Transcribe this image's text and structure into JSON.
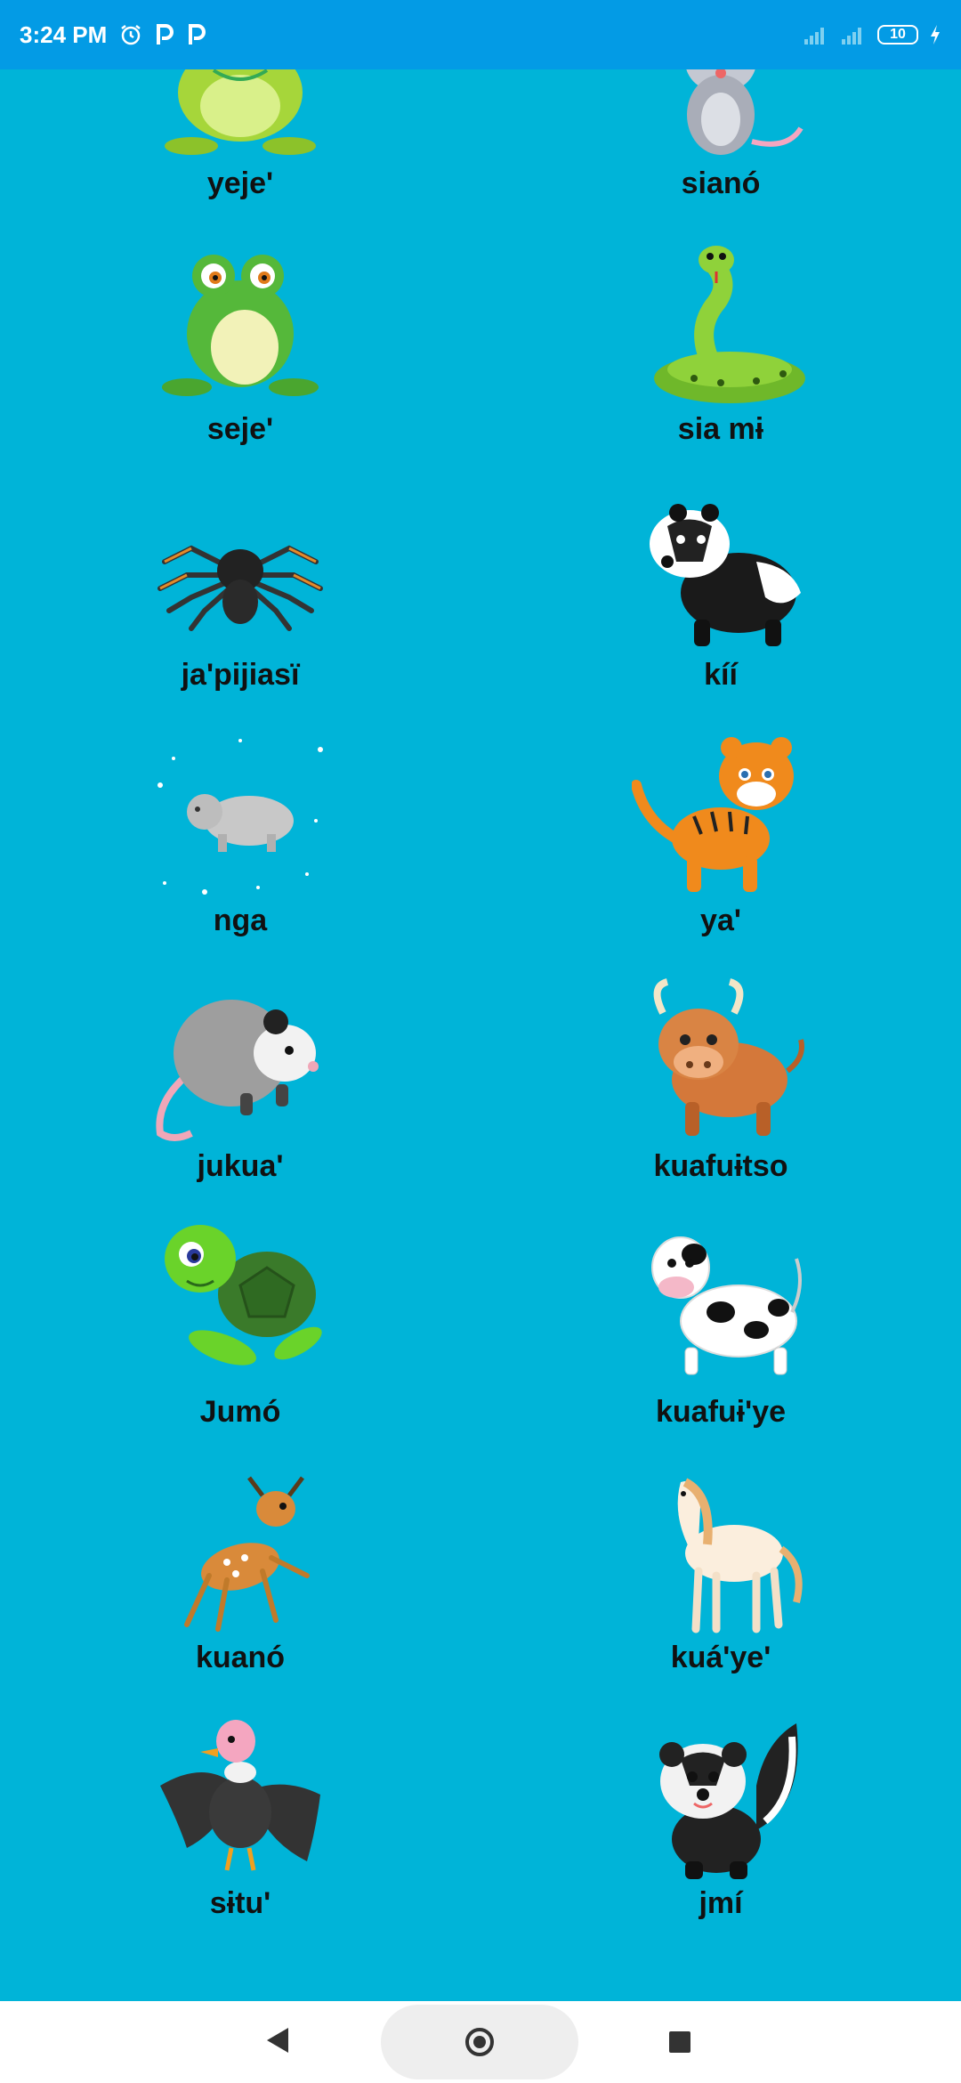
{
  "status_bar": {
    "time": "3:24 PM",
    "battery": "10"
  },
  "animals": [
    {
      "label": "yeje'",
      "icon": "frog-icon"
    },
    {
      "label": "sianó",
      "icon": "mouse-icon"
    },
    {
      "label": "seje'",
      "icon": "frog-icon"
    },
    {
      "label": "sia mɨ",
      "icon": "snake-icon"
    },
    {
      "label": "ja'pijiasï",
      "icon": "spider-icon"
    },
    {
      "label": "kíí",
      "icon": "badger-icon"
    },
    {
      "label": "nga",
      "icon": "bear-icon"
    },
    {
      "label": "ya'",
      "icon": "tiger-icon"
    },
    {
      "label": "jukua'",
      "icon": "opossum-icon"
    },
    {
      "label": "kuafuɨtso",
      "icon": "bull-icon"
    },
    {
      "label": "Jumó",
      "icon": "turtle-icon"
    },
    {
      "label": "kuafuɨ'ye",
      "icon": "cow-icon"
    },
    {
      "label": "kuanó",
      "icon": "deer-icon"
    },
    {
      "label": "kuá'ye'",
      "icon": "horse-icon"
    },
    {
      "label": "sɨtu'",
      "icon": "vulture-icon"
    },
    {
      "label": "jmí",
      "icon": "skunk-icon"
    }
  ]
}
